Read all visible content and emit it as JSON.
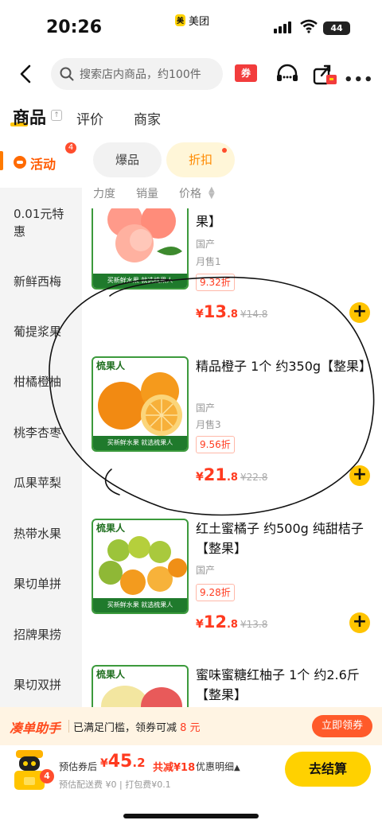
{
  "status": {
    "time": "20:26",
    "app": "美团",
    "battery": "44"
  },
  "nav": {
    "search_placeholder": "搜索店内商品，约100件",
    "coupon_label": "券"
  },
  "tabs": [
    {
      "label": "商品"
    },
    {
      "label": "评价"
    },
    {
      "label": "商家"
    }
  ],
  "sidebar": {
    "active": {
      "label": "活动",
      "badge": "4"
    },
    "items": [
      {
        "label": "0.01元特惠"
      },
      {
        "label": "新鲜西梅"
      },
      {
        "label": "葡提浆果"
      },
      {
        "label": "柑橘橙柚"
      },
      {
        "label": "桃李杏枣"
      },
      {
        "label": "瓜果苹梨"
      },
      {
        "label": "热带水果"
      },
      {
        "label": "果切单拼"
      },
      {
        "label": "招牌果捞"
      },
      {
        "label": "果切双拼"
      }
    ]
  },
  "chips": [
    {
      "label": "爆品"
    },
    {
      "label": "折扣"
    }
  ],
  "sort": [
    {
      "label": "力度"
    },
    {
      "label": "销量"
    },
    {
      "label": "价格"
    }
  ],
  "products": [
    {
      "name": "果】",
      "origin": "国产",
      "sales": "月售1",
      "discount": "9.32折",
      "currency": "¥",
      "price_int": "13",
      "price_dec": ".8",
      "orig_price": "¥14.8",
      "brand": "",
      "banner": "买新鲜水果 就选梳果人"
    },
    {
      "name": "精品橙子 1个 约350g【整果】",
      "origin": "国产",
      "sales": "月售3",
      "discount": "9.56折",
      "currency": "¥",
      "price_int": "21",
      "price_dec": ".8",
      "orig_price": "¥22.8",
      "brand": "梳果人",
      "banner": "买新鲜水果 就选梳果人"
    },
    {
      "name": "红土蜜橘子 约500g 纯甜桔子【整果】",
      "origin": "国产",
      "sales": "",
      "discount": "9.28折",
      "currency": "¥",
      "price_int": "12",
      "price_dec": ".8",
      "orig_price": "¥13.8",
      "brand": "梳果人",
      "banner": "买新鲜水果 就选梳果人"
    },
    {
      "name": "蜜味蜜糖红柚子 1个 约2.6斤【整果】",
      "brand": "梳果人"
    }
  ],
  "assistant": {
    "logo": "凑单助手",
    "text": "已满足门槛，领券可减",
    "amount": "8 元",
    "button": "立即领券"
  },
  "bottom": {
    "cart_badge": "4",
    "est_label": "预估券后",
    "currency": "¥",
    "price_int": "45",
    "price_dec": ".2",
    "save": "共减¥18",
    "detail": "优惠明细",
    "fees": "预估配送费 ¥0 | 打包费¥0.1",
    "checkout": "去结算"
  },
  "colors": {
    "accent": "#ffd100",
    "price": "#ff3a1f",
    "brand_green": "#1f7a2c"
  }
}
